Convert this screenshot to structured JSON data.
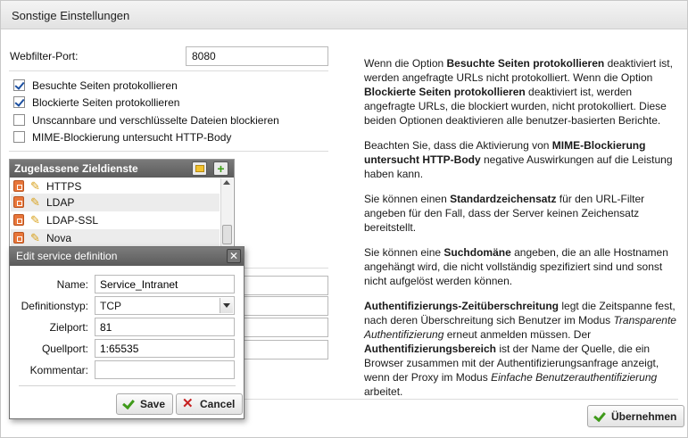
{
  "window": {
    "title": "Sonstige Einstellungen"
  },
  "webfilter": {
    "label": "Webfilter-Port:",
    "value": "8080"
  },
  "options": [
    {
      "label": "Besuchte Seiten protokollieren",
      "checked": true
    },
    {
      "label": "Blockierte Seiten protokollieren",
      "checked": true
    },
    {
      "label": "Unscannbare und verschlüsselte Dateien blockieren",
      "checked": false
    },
    {
      "label": "MIME-Blockierung untersucht HTTP-Body",
      "checked": false
    }
  ],
  "services": {
    "header": "Zugelassene Zieldienste",
    "add_icon": "add-icon",
    "folder_icon": "folder-icon",
    "items": [
      {
        "name": "HTTPS"
      },
      {
        "name": "LDAP"
      },
      {
        "name": "LDAP-SSL"
      },
      {
        "name": "Nova"
      }
    ]
  },
  "dialog": {
    "title": "Edit service definition",
    "name_label": "Name:",
    "name_value": "Service_Intranet",
    "type_label": "Definitionstyp:",
    "type_value": "TCP",
    "target_label": "Zielport:",
    "target_value": "81",
    "source_label": "Quellport:",
    "source_value": "1:65535",
    "comment_label": "Kommentar:",
    "comment_value": "",
    "save_label": "Save",
    "cancel_label": "Cancel"
  },
  "help": {
    "p1": [
      {
        "t": "Wenn die Option ",
        "b": false
      },
      {
        "t": "Besuchte Seiten protokollieren",
        "b": true
      },
      {
        "t": " deaktiviert ist, werden angefragte URLs nicht protokolliert. Wenn die Option ",
        "b": false
      },
      {
        "t": "Blockierte Seiten protokollieren",
        "b": true
      },
      {
        "t": " deaktiviert ist, werden angefragte URLs, die blockiert wurden, nicht protokolliert. Diese beiden Optionen deaktivieren alle benutzer-basierten Berichte.",
        "b": false
      }
    ],
    "p2": [
      {
        "t": "Beachten Sie, dass die Aktivierung von ",
        "b": false
      },
      {
        "t": "MIME-Blockierung untersucht HTTP-Body",
        "b": true
      },
      {
        "t": " negative Auswirkungen auf die Leistung haben kann.",
        "b": false
      }
    ],
    "p3": [
      {
        "t": "Sie können einen ",
        "b": false
      },
      {
        "t": "Standardzeichensatz",
        "b": true
      },
      {
        "t": " für den URL-Filter angeben für den Fall, dass der Server keinen Zeichensatz bereitstellt.",
        "b": false
      }
    ],
    "p4": [
      {
        "t": "Sie können eine ",
        "b": false
      },
      {
        "t": "Suchdomäne",
        "b": true
      },
      {
        "t": " angeben, die an alle Hostnamen angehängt wird, die nicht vollständig spezifiziert sind und sonst nicht aufgelöst werden können.",
        "b": false
      }
    ],
    "p5": [
      {
        "t": "Authentifizierungs-Zeitüberschreitung",
        "b": true
      },
      {
        "t": " legt die Zeitspanne fest, nach deren Überschreitung sich Benutzer im Modus ",
        "b": false
      },
      {
        "t": "Transparente Authentifizierung",
        "i": true
      },
      {
        "t": " erneut anmelden müssen. Der ",
        "b": false
      },
      {
        "t": "Authentifizierungsbereich",
        "b": true
      },
      {
        "t": " ist der Name der Quelle, die ein Browser zusammen mit der Authentifizierungsanfrage anzeigt, wenn der Proxy im Modus ",
        "b": false
      },
      {
        "t": "Einfache Benutzerauthentifizierung",
        "i": true
      },
      {
        "t": " arbeitet.",
        "b": false
      }
    ]
  },
  "footer": {
    "apply_label": "Übernehmen"
  }
}
